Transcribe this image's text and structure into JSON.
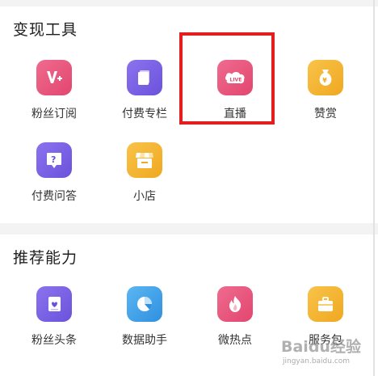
{
  "sections": [
    {
      "title": "变现工具",
      "items": [
        {
          "label": "粉丝订阅",
          "icon": "fan-subscribe-icon",
          "color": "#e8527a"
        },
        {
          "label": "付费专栏",
          "icon": "paid-column-icon",
          "color": "#7b63e6"
        },
        {
          "label": "直播",
          "icon": "live-icon",
          "color": "#e8527a"
        },
        {
          "label": "赞赏",
          "icon": "money-bag-icon",
          "color": "#f4b532"
        },
        {
          "label": "付费问答",
          "icon": "paid-qa-icon",
          "color": "#7b63e6"
        },
        {
          "label": "小店",
          "icon": "shop-icon",
          "color": "#f4b532"
        }
      ]
    },
    {
      "title": "推荐能力",
      "items": [
        {
          "label": "粉丝头条",
          "icon": "fan-headline-icon",
          "color": "#7b63e6"
        },
        {
          "label": "数据助手",
          "icon": "data-pie-icon",
          "color": "#39a0e8"
        },
        {
          "label": "微热点",
          "icon": "flame-icon",
          "color": "#e8527a"
        },
        {
          "label": "服务包",
          "icon": "service-pack-icon",
          "color": "#f4b532"
        }
      ]
    }
  ],
  "watermark": {
    "main": "Baidu经验",
    "sub": "jingyan.baidu.com"
  },
  "highlight_color": "#e41e1e"
}
